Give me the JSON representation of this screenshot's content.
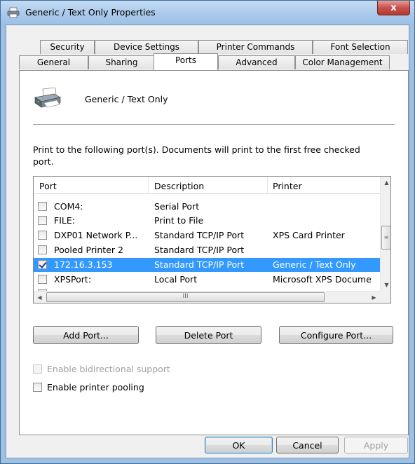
{
  "window": {
    "title": "Generic / Text Only Properties",
    "close_glyph": "x"
  },
  "tabs": {
    "row1": [
      "Security",
      "Device Settings",
      "Printer Commands",
      "Font Selection"
    ],
    "row2": [
      "General",
      "Sharing",
      "Ports",
      "Advanced",
      "Color Management"
    ],
    "active": "Ports"
  },
  "panel": {
    "printer_name": "Generic / Text Only",
    "instructions": "Print to the following port(s). Documents will print to the first free checked port."
  },
  "ports_list": {
    "columns": [
      "Port",
      "Description",
      "Printer"
    ],
    "rows": [
      {
        "checked": false,
        "port": "COM4:",
        "description": "Serial Port",
        "printer": ""
      },
      {
        "checked": false,
        "port": "FILE:",
        "description": "Print to File",
        "printer": ""
      },
      {
        "checked": false,
        "port": "DXP01 Network P...",
        "description": "Standard TCP/IP Port",
        "printer": "XPS Card Printer"
      },
      {
        "checked": false,
        "port": "Pooled Printer 2",
        "description": "Standard TCP/IP Port",
        "printer": ""
      },
      {
        "checked": true,
        "selected": true,
        "port": "172.16.3.153",
        "description": "Standard TCP/IP Port",
        "printer": "Generic / Text Only"
      },
      {
        "checked": false,
        "port": "XPSPort:",
        "description": "Local Port",
        "printer": "Microsoft XPS Docume"
      }
    ],
    "hscroll_grip": "III",
    "vscroll_grip": "≡"
  },
  "port_buttons": {
    "add": "Add Port...",
    "delete": "Delete Port",
    "configure": "Configure Port..."
  },
  "options": {
    "bidirectional": {
      "label": "Enable bidirectional support",
      "checked": false,
      "enabled": false
    },
    "pooling": {
      "label": "Enable printer pooling",
      "checked": false,
      "enabled": true
    }
  },
  "footer": {
    "ok": "OK",
    "cancel": "Cancel",
    "apply": "Apply"
  },
  "colors": {
    "selection": "#3399ff",
    "title_gradient": "#a8c8ea",
    "close_button": "#c75050"
  }
}
